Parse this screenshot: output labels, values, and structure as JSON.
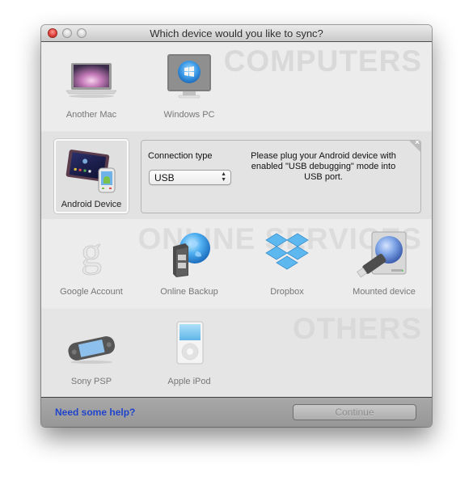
{
  "window": {
    "title": "Which device would you like to sync?"
  },
  "sections": {
    "computers": {
      "heading": "COMPUTERS",
      "items": [
        {
          "label": "Another Mac",
          "icon": "macbook-icon"
        },
        {
          "label": "Windows PC",
          "icon": "windows-pc-icon"
        }
      ]
    },
    "android": {
      "item": {
        "label": "Android Device",
        "icon": "android-device-icon",
        "selected": true
      },
      "panel": {
        "connection_label": "Connection type",
        "connection_value": "USB",
        "message": "Please plug your Android device with enabled \"USB debugging\" mode into USB port.",
        "close_glyph": "×"
      }
    },
    "online": {
      "heading": "ONLINE SERVICES",
      "items": [
        {
          "label": "Google Account",
          "icon": "google-icon"
        },
        {
          "label": "Online Backup",
          "icon": "online-backup-icon"
        },
        {
          "label": "Dropbox",
          "icon": "dropbox-icon"
        },
        {
          "label": "Mounted device",
          "icon": "mounted-device-icon"
        }
      ]
    },
    "others": {
      "heading": "OTHERS",
      "items": [
        {
          "label": "Sony PSP",
          "icon": "psp-icon"
        },
        {
          "label": "Apple iPod",
          "icon": "ipod-icon"
        }
      ]
    }
  },
  "footer": {
    "help_link": "Need some help?",
    "continue_label": "Continue",
    "continue_enabled": false
  },
  "colors": {
    "link": "#1f44cc",
    "close_button": "#e0443e"
  }
}
